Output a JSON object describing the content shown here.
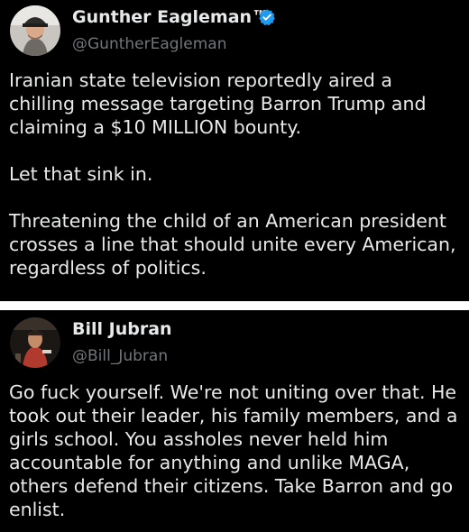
{
  "tweets": [
    {
      "display_name": "Gunther Eagleman™",
      "handle": "@GuntherEagleman",
      "verified": true,
      "avatar_icon": "user-avatar",
      "badge_color": "#1d9bf0",
      "paragraphs": [
        "Iranian state television reportedly aired a chilling message targeting Barron Trump and claiming a $10 MILLION bounty.",
        "Let that sink in.",
        "Threatening the child of an American president crosses a line that should unite every American, regardless of politics."
      ]
    },
    {
      "display_name": "Bill Jubran",
      "handle": "@Bill_Jubran",
      "verified": false,
      "avatar_icon": "user-avatar",
      "paragraphs": [
        "Go fuck yourself. We're not uniting over that. He took out their leader, his family members, and a girls school. You assholes never held him accountable for anything and unlike MAGA, others defend their citizens. Take Barron and go enlist."
      ]
    }
  ],
  "colors": {
    "background": "#000000",
    "text": "#e7e9ea",
    "secondary_text": "#71767b",
    "divider": "#ffffff"
  }
}
